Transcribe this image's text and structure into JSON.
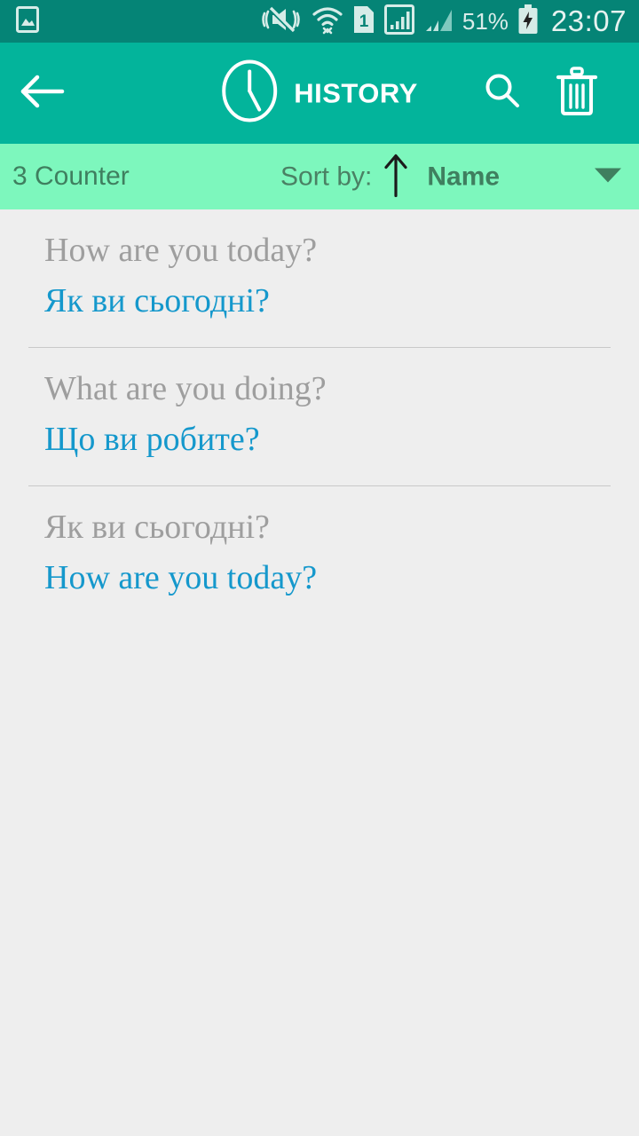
{
  "status_bar": {
    "time": "23:07",
    "battery_percent": "51%",
    "icons": [
      "photo-icon",
      "vibrate-mute-icon",
      "wifi-icon",
      "sim1-icon",
      "signal-bars-icon",
      "signal-bars-secondary-icon",
      "battery-charging-icon"
    ],
    "sim_label": "1",
    "background_color": "#058476"
  },
  "app_bar": {
    "title": "HISTORY",
    "back_icon": "arrow-left-icon",
    "title_icon": "clock-icon",
    "search_icon": "search-icon",
    "delete_icon": "trash-icon",
    "background_color": "#03b49b"
  },
  "sort_bar": {
    "counter": "3 Counter",
    "sort_by_label": "Sort by:",
    "sort_direction_icon": "arrow-up-icon",
    "sort_value": "Name",
    "dropdown_icon": "caret-down-icon",
    "background_color": "#7df7bd"
  },
  "list": {
    "items": [
      {
        "source": "How are you today?",
        "target": "Як ви сьогодні?",
        "divider": true
      },
      {
        "source": "What are you doing?",
        "target": "Що ви робите?",
        "divider": true
      },
      {
        "source": "Як ви сьогодні?",
        "target": "How are you today?",
        "divider": false
      }
    ],
    "source_color": "#9e9e9e",
    "target_color": "#1598cc",
    "background_color": "#eeeeee"
  }
}
